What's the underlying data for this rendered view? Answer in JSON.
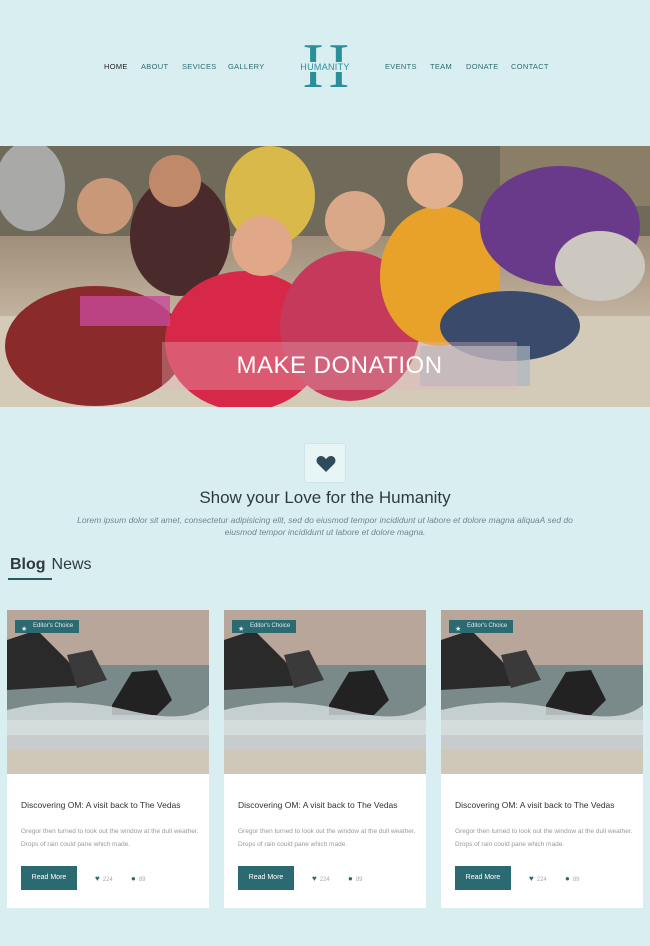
{
  "nav": {
    "left": [
      "HOME",
      "ABOUT",
      "SEVICES",
      "GALLERY"
    ],
    "right": [
      "EVENTS",
      "TEAM",
      "DONATE",
      "CONTACT"
    ]
  },
  "logo": {
    "letter": "H",
    "word": "HUMANITY"
  },
  "hero": {
    "caption": "MAKE DONATION"
  },
  "love": {
    "icon": "heart-icon",
    "title": "Show your Love for the Humanity",
    "text": "Lorem ipsum dolor sit amet, consectetur adipisicing elit, sed do eiusmod tempor incididunt ut labore et dolore magna aliquaA sed do eiusmod tempor incididunt ut labore et dolore magna."
  },
  "blog": {
    "title_bold": "Blog",
    "title_rest": "News"
  },
  "cards": [
    {
      "badge": "Editor's Choice",
      "title": "Discovering OM: A visit back to The Vedas",
      "text": "Gregor then turned to look out the window at the dull weather. Drops of rain could pane which made.",
      "button": "Read More",
      "likes": "224",
      "comments": "89"
    },
    {
      "badge": "Editor's Choice",
      "title": "Discovering OM: A visit back to The Vedas",
      "text": "Gregor then turned to look out the window at the dull weather. Drops of rain could pane which made.",
      "button": "Read More",
      "likes": "224",
      "comments": "89"
    },
    {
      "badge": "Editor's Choice",
      "title": "Discovering OM: A visit back to The Vedas",
      "text": "Gregor then turned to look out the window at the dull weather. Drops of rain could pane which made.",
      "button": "Read More",
      "likes": "224",
      "comments": "89"
    }
  ],
  "colors": {
    "background": "#d9eef0",
    "accent": "#2c6a72",
    "logo": "#2a8f99"
  }
}
